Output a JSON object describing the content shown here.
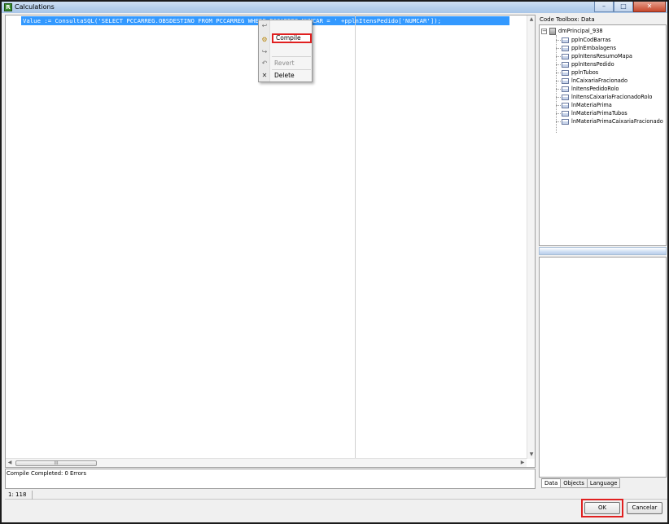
{
  "window": {
    "title": "Calculations",
    "app_icon_glyph": "R",
    "controls": {
      "minimize": "–",
      "maximize": "□",
      "close": "✕"
    }
  },
  "editor": {
    "code_line": "Value := ConsultaSQL('SELECT PCCARREG.OBSDESTINO FROM PCCARREG WHERE PCCARREG.NUMCAR = ' +pplnItensPedido['NUMCAR']);",
    "scroll_thumb_grip": "III"
  },
  "context_menu": {
    "items": [
      {
        "label": "Compile",
        "icon": "compile-icon",
        "glyph": "⚙",
        "enabled": true,
        "highlighted": true
      },
      {
        "label": "Revert",
        "icon": "revert-icon",
        "glyph": "↶",
        "enabled": false
      },
      {
        "label": "Delete",
        "icon": "delete-icon",
        "glyph": "✕",
        "enabled": true
      }
    ],
    "top_icons": [
      "↩",
      "↪"
    ]
  },
  "toolbox": {
    "title": "Code Toolbox: Data",
    "root": "dmPrincipal_938",
    "items": [
      "pplnCodBarras",
      "pplnEmbalagens",
      "pplnItensResumoMapa",
      "pplnItensPedido",
      "pplnTubos",
      "lnCaixariaFracionado",
      "lnItensPedidoRolo",
      "lnItensCaixariaFracionadoRolo",
      "lnMateriaPrima",
      "lnMateriaPrimaTubos",
      "lnMateriaPrimaCaixariaFracionado"
    ],
    "tabs": [
      "Data",
      "Objects",
      "Language"
    ],
    "active_tab": "Data"
  },
  "output": {
    "message": "Compile Completed: 0 Errors"
  },
  "status": {
    "position": "1: 118"
  },
  "buttons": {
    "ok": "OK",
    "cancel": "Cancelar"
  }
}
